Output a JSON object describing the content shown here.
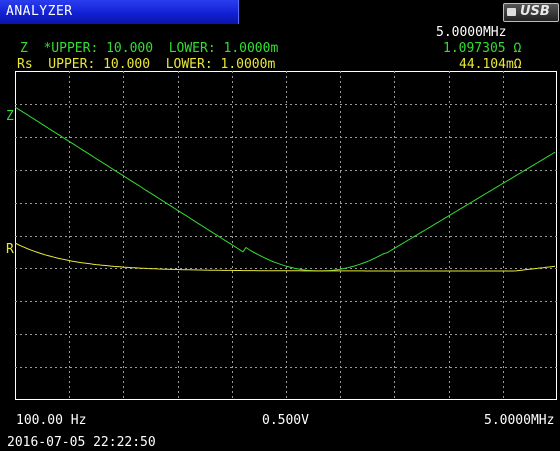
{
  "header": {
    "title": "ANALYZER",
    "usb_label": "USB"
  },
  "readout": {
    "frequency": "5.0000MHz",
    "z_line": "Z  *UPPER: 10.000  LOWER: 1.0000m",
    "z_value": "1.097305 Ω",
    "rs_line": "Rs  UPPER: 10.000  LOWER: 1.0000m",
    "rs_value": "44.104mΩ"
  },
  "plot": {
    "z_marker": "Z",
    "r_marker": "R",
    "colors": {
      "z": "#33dd33",
      "rs": "#e8e838",
      "grid": "#9a9a9a"
    }
  },
  "footer": {
    "start_freq": "100.00 Hz",
    "level": "0.500V",
    "stop_freq": "5.0000MHz",
    "timestamp": "2016-07-05 22:22:50"
  }
}
